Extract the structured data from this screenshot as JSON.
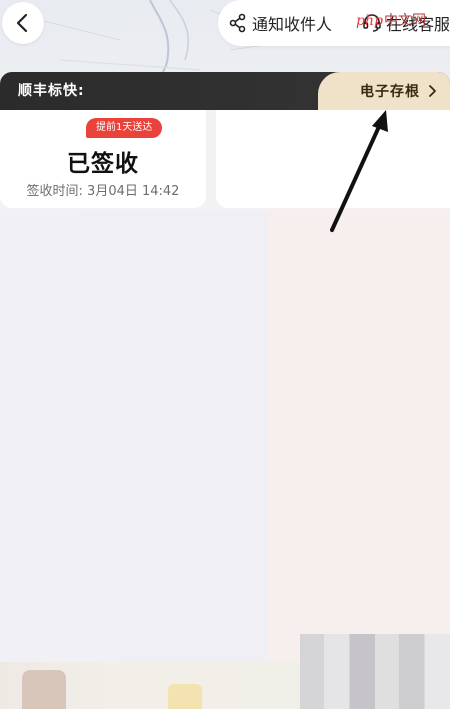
{
  "header": {
    "back_icon": "chevron-left-icon",
    "notify_label": "通知收件人",
    "notify_icon": "share-icon",
    "service_label": "在线客服",
    "service_icon": "headset-icon"
  },
  "watermark": {
    "php": "php",
    "site": "中文网"
  },
  "carrier": {
    "name": "顺丰标快:",
    "archive_label": "电子存根",
    "archive_icon": "chevron-right-icon"
  },
  "status": {
    "badge": "提前1天送达",
    "title": "已签收",
    "signed_time": "签收时间: 3月04日 14:42"
  },
  "colors": {
    "accent_red": "#e8423b",
    "carrier_bar": "#2b2b2b",
    "archive_tab": "#efe2c8"
  }
}
